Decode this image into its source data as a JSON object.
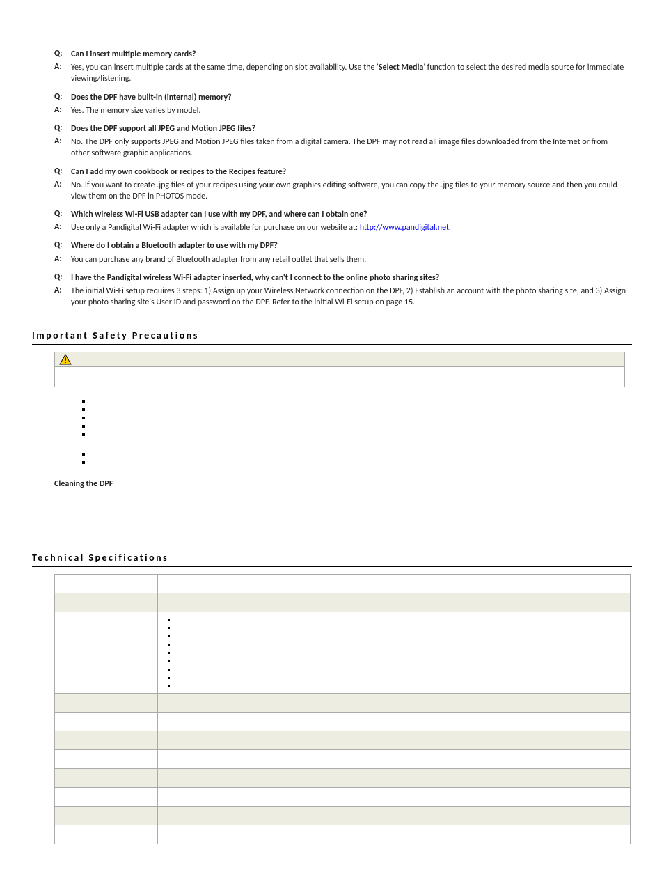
{
  "faq": [
    {
      "q": "Can I insert multiple memory cards?",
      "a_pre": "Yes, you can insert multiple cards at the same time, depending on slot availability. Use the '",
      "a_bold": "Select Media",
      "a_post": "' function to select the desired media source for immediate viewing/listening."
    },
    {
      "q": "Does the DPF have built-in (internal) memory?",
      "a": "Yes. The memory size varies by model."
    },
    {
      "q": "Does the DPF support all JPEG and Motion JPEG files?",
      "a": "No. The DPF only supports JPEG and Motion JPEG files taken from a digital camera. The DPF may not read all image files downloaded from the Internet or from other software graphic applications."
    },
    {
      "q": "Can I add my own cookbook or recipes to the Recipes feature?",
      "a": "No. If you want to create .jpg files of your recipes using your own graphics editing software, you can copy the .jpg files to your memory source and then you could view them on the DPF in PHOTOS mode."
    },
    {
      "q": "Which wireless Wi-Fi USB adapter can I use with my DPF, and where can I obtain one?",
      "a_pre": "Use only a Pandigital Wi-Fi adapter which is available for purchase on our website at: ",
      "a_link_text": "http://www.pandigital.net",
      "a_post": "."
    },
    {
      "q": "Where do I obtain a Bluetooth adapter to use with my DPF?",
      "a": "You can purchase any brand of Bluetooth adapter from any retail outlet that sells them."
    },
    {
      "q": "I have the Pandigital wireless Wi-Fi adapter inserted, why can't I connect to the online photo sharing sites?",
      "a": "The initial Wi-Fi setup requires 3 steps: 1) Assign up your Wireless Network connection on the DPF, 2) Establish an account with the photo sharing site, and 3) Assign your photo sharing site's User ID and password on the DPF. Refer to the initial Wi-Fi setup on page 15."
    }
  ],
  "labels": {
    "q": "Q:",
    "a": "A:"
  },
  "section_safety": "Important Safety Precautions",
  "section_tech": "Technical Specifications",
  "subhead_cleaning": "Cleaning the DPF",
  "link_href": "http://www.pandigital.net"
}
